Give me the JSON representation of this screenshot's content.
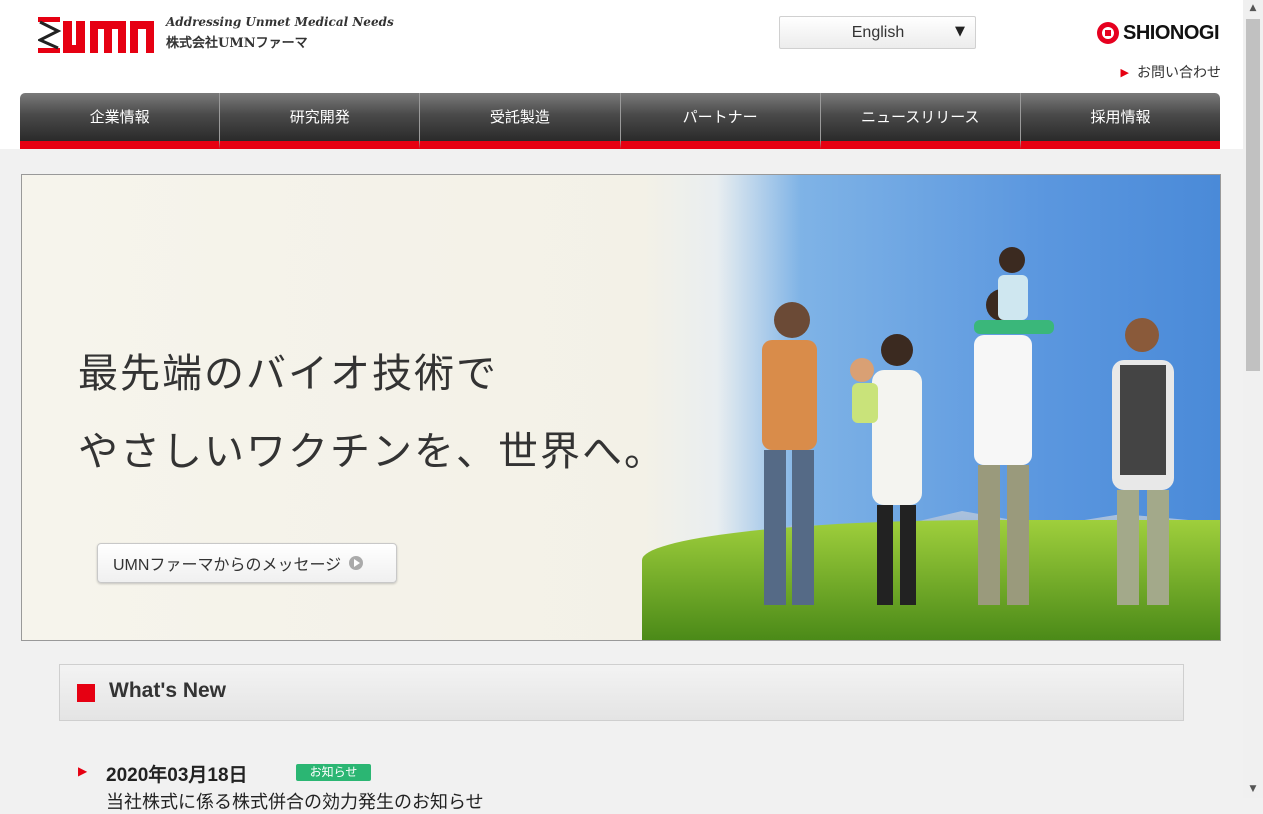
{
  "header": {
    "logo_text": "umn",
    "tagline": "Addressing Unmet Medical Needs",
    "company": "株式会社UMNファーマ",
    "language_select": {
      "value": "English"
    },
    "partner_logo": "SHIONOGI",
    "contact_link": "お問い合わせ"
  },
  "nav": {
    "items": [
      {
        "label": "企業情報"
      },
      {
        "label": "研究開発"
      },
      {
        "label": "受託製造"
      },
      {
        "label": "パートナー"
      },
      {
        "label": "ニュースリリース"
      },
      {
        "label": "採用情報"
      }
    ]
  },
  "hero": {
    "line1": "最先端のバイオ技術で",
    "line2": "やさしいワクチンを、世界へ。",
    "button_label": "UMNファーマからのメッセージ"
  },
  "whats_new": {
    "title": "What's New",
    "items": [
      {
        "date": "2020年03月18日",
        "tag": "お知らせ",
        "text": "当社株式に係る株式併合の効力発生のお知らせ"
      }
    ]
  },
  "colors": {
    "accent_red": "#e60012",
    "badge_green": "#2bb673",
    "nav_dark": "#3a3a3a"
  }
}
